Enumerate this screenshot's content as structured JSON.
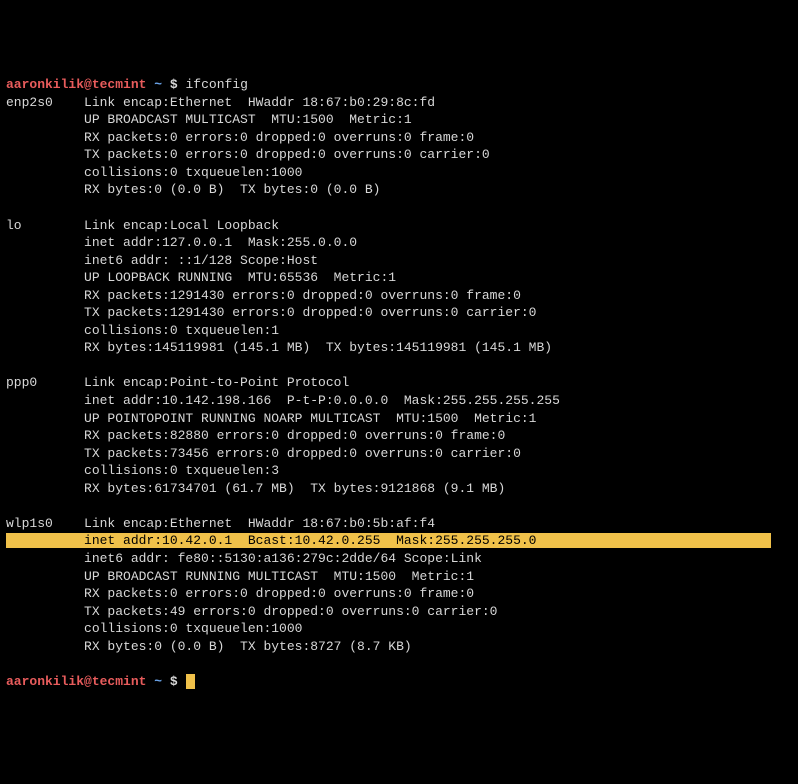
{
  "prompt": {
    "user": "aaronkilik@tecmint",
    "path": "~",
    "sep": "$",
    "command": "ifconfig"
  },
  "interfaces": [
    {
      "name": "enp2s0",
      "lines": [
        "Link encap:Ethernet  HWaddr 18:67:b0:29:8c:fd",
        "UP BROADCAST MULTICAST  MTU:1500  Metric:1",
        "RX packets:0 errors:0 dropped:0 overruns:0 frame:0",
        "TX packets:0 errors:0 dropped:0 overruns:0 carrier:0",
        "collisions:0 txqueuelen:1000",
        "RX bytes:0 (0.0 B)  TX bytes:0 (0.0 B)"
      ]
    },
    {
      "name": "lo",
      "lines": [
        "Link encap:Local Loopback",
        "inet addr:127.0.0.1  Mask:255.0.0.0",
        "inet6 addr: ::1/128 Scope:Host",
        "UP LOOPBACK RUNNING  MTU:65536  Metric:1",
        "RX packets:1291430 errors:0 dropped:0 overruns:0 frame:0",
        "TX packets:1291430 errors:0 dropped:0 overruns:0 carrier:0",
        "collisions:0 txqueuelen:1",
        "RX bytes:145119981 (145.1 MB)  TX bytes:145119981 (145.1 MB)"
      ]
    },
    {
      "name": "ppp0",
      "lines": [
        "Link encap:Point-to-Point Protocol",
        "inet addr:10.142.198.166  P-t-P:0.0.0.0  Mask:255.255.255.255",
        "UP POINTOPOINT RUNNING NOARP MULTICAST  MTU:1500  Metric:1",
        "RX packets:82880 errors:0 dropped:0 overruns:0 frame:0",
        "TX packets:73456 errors:0 dropped:0 overruns:0 carrier:0",
        "collisions:0 txqueuelen:3",
        "RX bytes:61734701 (61.7 MB)  TX bytes:9121868 (9.1 MB)"
      ]
    },
    {
      "name": "wlp1s0",
      "highlight_index": 1,
      "lines": [
        "Link encap:Ethernet  HWaddr 18:67:b0:5b:af:f4",
        "inet addr:10.42.0.1  Bcast:10.42.0.255  Mask:255.255.255.0",
        "inet6 addr: fe80::5130:a136:279c:2dde/64 Scope:Link",
        "UP BROADCAST RUNNING MULTICAST  MTU:1500  Metric:1",
        "RX packets:0 errors:0 dropped:0 overruns:0 frame:0",
        "TX packets:49 errors:0 dropped:0 overruns:0 carrier:0",
        "collisions:0 txqueuelen:1000",
        "RX bytes:0 (0.0 B)  TX bytes:8727 (8.7 KB)"
      ]
    }
  ]
}
